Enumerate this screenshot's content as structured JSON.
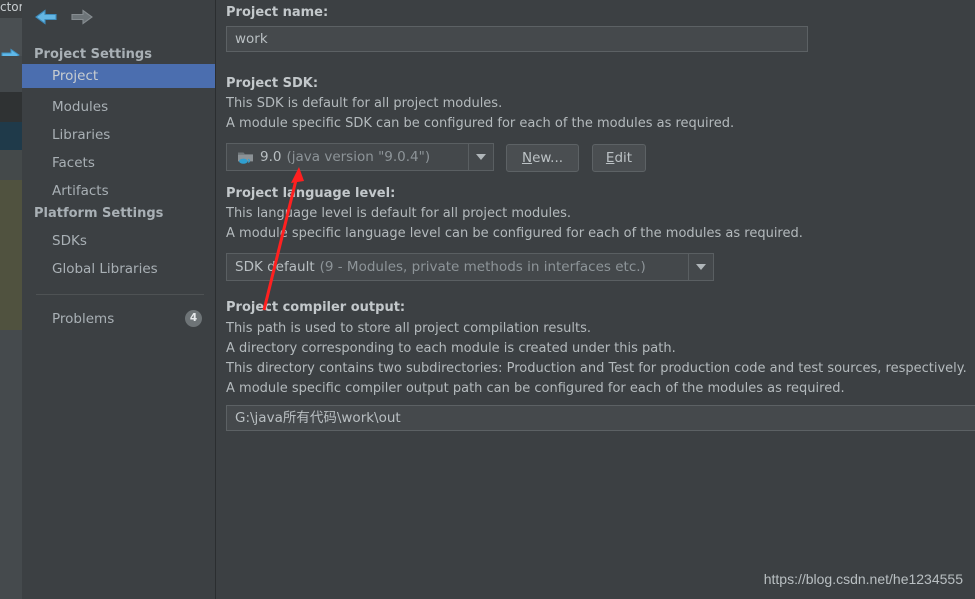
{
  "background": {
    "partial_menu_text": "ctor",
    "arrow_icon": "right-arrow-icon"
  },
  "sidebar": {
    "nav": {
      "back_icon": "back-arrow-icon",
      "forward_icon": "forward-arrow-icon"
    },
    "groups": [
      {
        "header": "Project Settings",
        "items": [
          {
            "label": "Project",
            "selected": true
          },
          {
            "label": "Modules",
            "selected": false
          },
          {
            "label": "Libraries",
            "selected": false
          },
          {
            "label": "Facets",
            "selected": false
          },
          {
            "label": "Artifacts",
            "selected": false
          }
        ]
      },
      {
        "header": "Platform Settings",
        "items": [
          {
            "label": "SDKs",
            "selected": false
          },
          {
            "label": "Global Libraries",
            "selected": false
          }
        ]
      }
    ],
    "problems": {
      "label": "Problems",
      "count": "4"
    }
  },
  "main": {
    "project_name": {
      "label": "Project name:",
      "value": "work"
    },
    "project_sdk": {
      "label": "Project SDK:",
      "desc_line1": "This SDK is default for all project modules.",
      "desc_line2": "A module specific SDK can be configured for each of the modules as required.",
      "icon": "java-sdk-folder-icon",
      "value": "9.0",
      "value_detail": "(java version \"9.0.4\")",
      "new_button": {
        "mnemonic": "N",
        "rest": "ew..."
      },
      "edit_button": {
        "mnemonic": "E",
        "rest": "dit"
      }
    },
    "language_level": {
      "label": "Project language level:",
      "desc_line1": "This language level is default for all project modules.",
      "desc_line2": "A module specific language level can be configured for each of the modules as required.",
      "value": "SDK default",
      "value_detail": "(9 - Modules, private methods in interfaces etc.)"
    },
    "compiler_output": {
      "label": "Project compiler output:",
      "desc_line1": "This path is used to store all project compilation results.",
      "desc_line2": "A directory corresponding to each module is created under this path.",
      "desc_line3": "This directory contains two subdirectories: Production and Test for production code and test sources, respectively.",
      "desc_line4": "A module specific compiler output path can be configured for each of the modules as required.",
      "value": "G:\\java所有代码\\work\\out"
    }
  },
  "annotation": {
    "arrow_color": "#ff2020"
  },
  "watermark": "https://blog.csdn.net/he1234555"
}
